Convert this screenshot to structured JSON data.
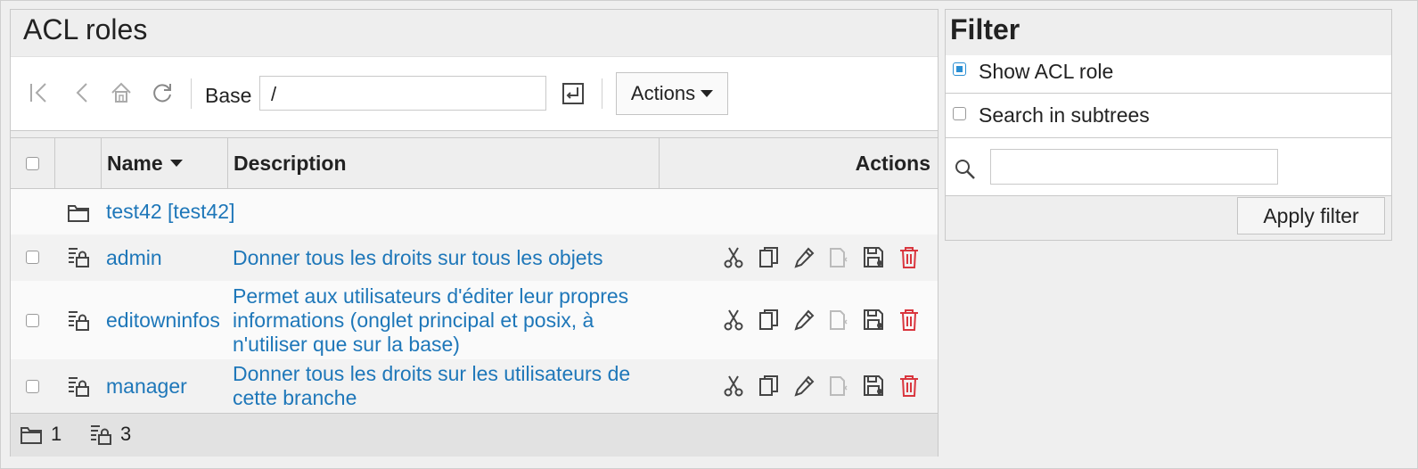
{
  "left_panel": {
    "title": "ACL roles",
    "toolbar": {
      "first_icon": "first-page-icon",
      "prev_icon": "previous-icon",
      "home_icon": "home-icon",
      "reload_icon": "reload-icon",
      "base_label": "Base",
      "base_value": "/",
      "submit_icon": "enter-icon",
      "actions_label": "Actions"
    },
    "table": {
      "columns": {
        "name": "Name",
        "description": "Description",
        "actions": "Actions"
      },
      "sort_indicator": "sort-descending",
      "department": {
        "label": "test42 [test42]",
        "icon": "folder-icon"
      },
      "rows": [
        {
          "name": "admin",
          "description": "Donner tous les droits sur tous les objets"
        },
        {
          "name": "editowninfos",
          "description_lines": [
            "Permet aux utilisateurs d'éditer leur propres",
            "informations (onglet principal et posix, à",
            "n'utiliser que sur la base)"
          ]
        },
        {
          "name": "manager",
          "description_lines": [
            "Donner tous les droits sur les utilisateurs de",
            "cette branche"
          ]
        }
      ],
      "row_action_icons": [
        "cut-icon",
        "copy-icon",
        "edit-icon",
        "paste-icon",
        "snapshot-icon",
        "delete-icon"
      ],
      "footer": {
        "folder_count": "1",
        "role_count": "3"
      }
    }
  },
  "filter_panel": {
    "title": "Filter",
    "show_acl_role": {
      "label": "Show ACL role",
      "checked": true
    },
    "search_subtrees": {
      "label": "Search in subtrees",
      "checked": false
    },
    "search_value": "",
    "apply_label": "Apply filter"
  },
  "colors": {
    "link": "#1e77b9",
    "delete": "#d9363e",
    "checkbox_accent": "#2a8fd4"
  }
}
